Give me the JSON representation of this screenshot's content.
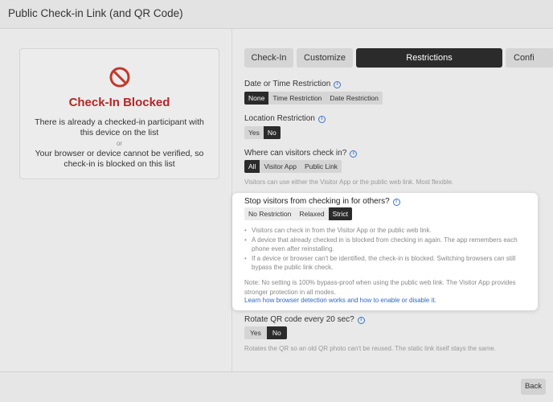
{
  "window": {
    "title": "Public Check-in Link (and QR Code)"
  },
  "status_card": {
    "title": "Check-In Blocked",
    "message1": "There is already a checked-in participant with this device on the list",
    "or": "or",
    "message2": "Your browser or device cannot be verified, so check-in is blocked on this list",
    "accent_color": "#b52626"
  },
  "tabs": [
    {
      "label": "Check-In",
      "active": false
    },
    {
      "label": "Customize",
      "active": false
    },
    {
      "label": "Restrictions",
      "active": true
    },
    {
      "label": "Confi",
      "active": false
    }
  ],
  "date_restriction": {
    "label": "Date or Time Restriction",
    "options": [
      "None",
      "Time Restriction",
      "Date Restriction"
    ],
    "selected": "None"
  },
  "location_restriction": {
    "label": "Location Restriction",
    "options": [
      "Yes",
      "No"
    ],
    "selected": "No"
  },
  "checkin_where": {
    "label": "Where can visitors check in?",
    "options": [
      "All",
      "Visitor App",
      "Public Link"
    ],
    "selected": "All",
    "hint": "Visitors can use either the Visitor App or the public web link. Most flexible."
  },
  "stop_others": {
    "label": "Stop visitors from checking in for others?",
    "options": [
      "No Restriction",
      "Relaxed",
      "Strict"
    ],
    "selected": "Strict",
    "bullets": [
      "Visitors can check in from the Visitor App or the public web link.",
      "A device that already checked in is blocked from checking in again. The app remembers each phone even after reinstalling.",
      "If a device or browser can't be identified, the check-in is blocked. Switching browsers can still bypass the public link check."
    ],
    "note": "Note: No setting is 100% bypass-proof when using the public web link. The Visitor App provides stronger protection in all modes.",
    "link": "Learn how browser detection works and how to enable or disable it."
  },
  "rotate_qr": {
    "label": "Rotate QR code every 20 sec?",
    "options": [
      "Yes",
      "No"
    ],
    "selected": "No",
    "hint": "Rotates the QR so an old QR photo can't be reused. The static link itself stays the same."
  },
  "footer": {
    "back_label": "Back"
  },
  "icons": {
    "block": "prohibited-icon",
    "info": "info-icon"
  }
}
